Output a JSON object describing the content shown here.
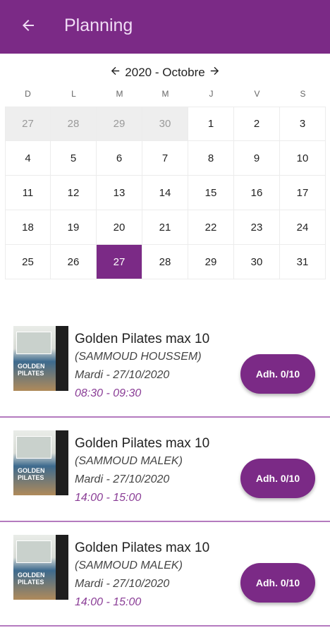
{
  "header": {
    "title": "Planning",
    "back_icon": "arrow-left-icon",
    "background": "#7b2a86"
  },
  "calendar": {
    "month_label": "2020 - Octobre",
    "prev_icon": "arrow-left-icon",
    "next_icon": "arrow-right-icon",
    "weekdays": [
      "D",
      "L",
      "M",
      "M",
      "J",
      "V",
      "S"
    ],
    "weeks": [
      [
        "27",
        "28",
        "29",
        "30",
        "1",
        "2",
        "3"
      ],
      [
        "4",
        "5",
        "6",
        "7",
        "8",
        "9",
        "10"
      ],
      [
        "11",
        "12",
        "13",
        "14",
        "15",
        "16",
        "17"
      ],
      [
        "18",
        "19",
        "20",
        "21",
        "22",
        "23",
        "24"
      ],
      [
        "25",
        "26",
        "27",
        "28",
        "29",
        "30",
        "31"
      ]
    ],
    "outside_days_count": 4,
    "selected_week": 4,
    "selected_day_index": 2,
    "accent": "#7b2a86"
  },
  "sessions": [
    {
      "title": "Golden Pilates max 10",
      "coach": "(SAMMOUD HOUSSEM)",
      "date": "Mardi - 27/10/2020",
      "time": "08:30 - 09:30",
      "button": "Adh. 0/10",
      "thumb_text": "GOLDEN PILATES"
    },
    {
      "title": "Golden Pilates max 10",
      "coach": "(SAMMOUD MALEK)",
      "date": "Mardi - 27/10/2020",
      "time": "14:00 - 15:00",
      "button": "Adh. 0/10",
      "thumb_text": "GOLDEN PILATES"
    },
    {
      "title": "Golden Pilates max 10",
      "coach": "(SAMMOUD MALEK)",
      "date": "Mardi - 27/10/2020",
      "time": "14:00 - 15:00",
      "button": "Adh. 0/10",
      "thumb_text": "GOLDEN PILATES"
    }
  ]
}
